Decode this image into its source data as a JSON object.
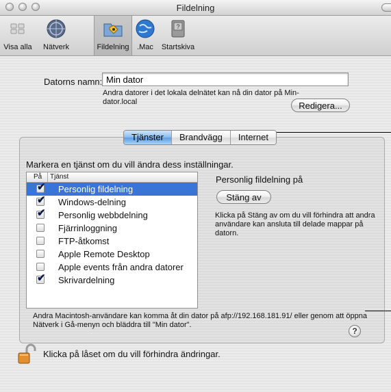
{
  "window": {
    "title": "Fildelning"
  },
  "toolbar": {
    "items": [
      {
        "label": "Visa alla"
      },
      {
        "label": "Nätverk"
      },
      {
        "label": "Fildelning"
      },
      {
        "label": ".Mac"
      },
      {
        "label": "Startskiva"
      }
    ]
  },
  "computer_name": {
    "label": "Datorns namn:",
    "value": "Min dator",
    "description": "Andra datorer i det lokala delnätet kan nå din dator på Min-dator.local",
    "edit_button": "Redigera..."
  },
  "tabs": [
    {
      "label": "Tjänster",
      "active": true
    },
    {
      "label": "Brandvägg",
      "active": false
    },
    {
      "label": "Internet",
      "active": false
    }
  ],
  "services": {
    "instruction": "Markera en tjänst om du vill ändra dess inställningar.",
    "columns": {
      "on": "På",
      "service": "Tjänst"
    },
    "items": [
      {
        "name": "Personlig fildelning",
        "checked": true,
        "selected": true
      },
      {
        "name": "Windows-delning",
        "checked": true,
        "selected": false
      },
      {
        "name": "Personlig webbdelning",
        "checked": true,
        "selected": false
      },
      {
        "name": "Fjärrinloggning",
        "checked": false,
        "selected": false
      },
      {
        "name": "FTP-åtkomst",
        "checked": false,
        "selected": false
      },
      {
        "name": "Apple Remote Desktop",
        "checked": false,
        "selected": false
      },
      {
        "name": "Apple events från andra datorer",
        "checked": false,
        "selected": false
      },
      {
        "name": "Skrivardelning",
        "checked": true,
        "selected": false
      }
    ],
    "status_title": "Personlig fildelning på",
    "stop_button": "Stäng av",
    "info": "Klicka på Stäng av om du vill förhindra att andra användare kan ansluta till delade mappar på datorn.",
    "access_text": "Andra Macintosh-användare kan komma åt din dator på afp://192.168.181.91/ eller genom att öppna Nätverk i Gå-menyn och bläddra till \"Min dator\".",
    "help": "?"
  },
  "lock": {
    "text": "Klicka på låset om du vill förhindra ändringar."
  },
  "colors": {
    "selection": "#3875d7",
    "tab_active": "#6aa8ea"
  }
}
